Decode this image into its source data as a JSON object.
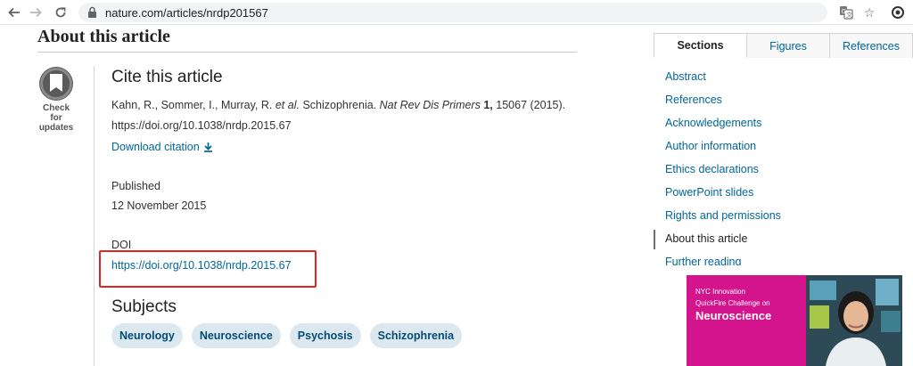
{
  "browser": {
    "url": "nature.com/articles/nrdp201567",
    "icons": [
      "back-arrow-icon",
      "forward-arrow-icon",
      "reload-icon",
      "lock-icon",
      "translate-icon",
      "star-icon",
      "extension-icon"
    ]
  },
  "article": {
    "heading": "About this article",
    "check_updates": "Check for updates"
  },
  "cite": {
    "title": "Cite this article",
    "authors": "Kahn, R., Sommer, I., Murray, R.",
    "et_al": "et al.",
    "article_title": "Schizophrenia.",
    "journal": "Nat Rev Dis Primers",
    "volume": "1,",
    "details": "15067 (2015).",
    "doi_url": "https://doi.org/10.1038/nrdp.2015.67",
    "download_label": "Download citation"
  },
  "published": {
    "label": "Published",
    "date": "12 November 2015"
  },
  "doi": {
    "label": "DOI",
    "link": "https://doi.org/10.1038/nrdp.2015.67",
    "highlight_color": "#e0271f"
  },
  "subjects": {
    "title": "Subjects",
    "items": [
      "Neurology",
      "Neuroscience",
      "Psychosis",
      "Schizophrenia"
    ]
  },
  "sidebar": {
    "tabs": [
      "Sections",
      "Figures",
      "References"
    ],
    "active_tab": "Sections",
    "sections": [
      "Abstract",
      "References",
      "Acknowledgements",
      "Author information",
      "Ethics declarations",
      "PowerPoint slides",
      "Rights and permissions",
      "About this article",
      "Further reading"
    ],
    "active_section": "About this article"
  },
  "ad": {
    "line1": "NYC Innovation",
    "line2": "QuickFire Challenge on",
    "line3": "Neuroscience",
    "background": "#d4148c"
  },
  "colors": {
    "link": "#006699",
    "chip_bg": "#dce8f0",
    "chip_text": "#024c74"
  }
}
